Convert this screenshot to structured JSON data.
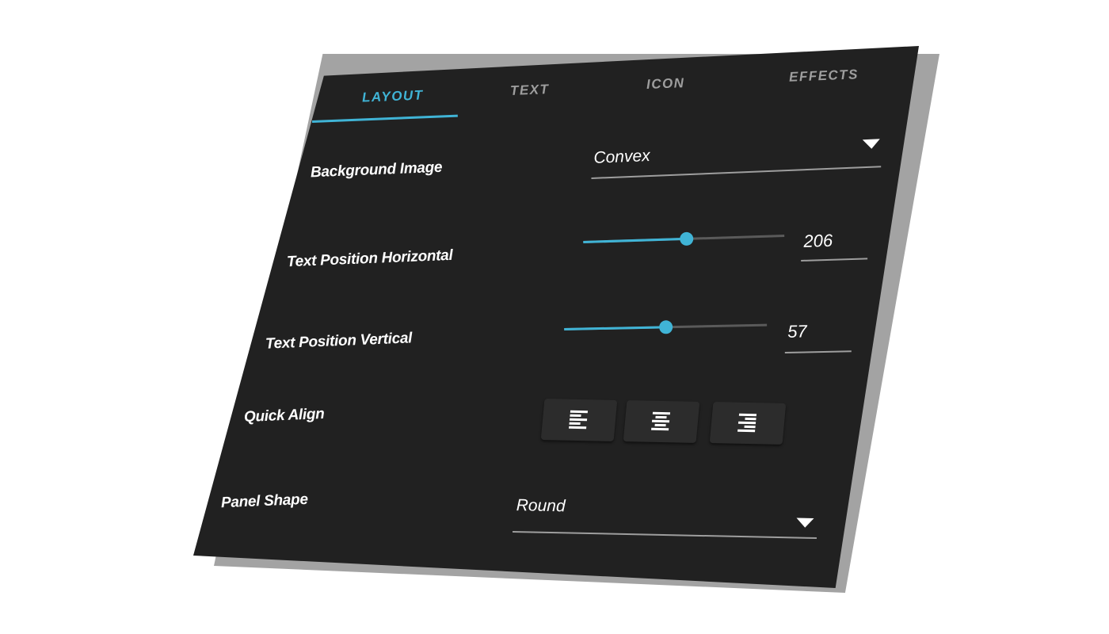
{
  "tabs": [
    {
      "label": "LAYOUT",
      "active": true
    },
    {
      "label": "TEXT",
      "active": false
    },
    {
      "label": "ICON",
      "active": false
    },
    {
      "label": "EFFECTS",
      "active": false
    }
  ],
  "rows": {
    "background_image": {
      "label": "Background Image",
      "value": "Convex",
      "icon": "chevron-down-icon"
    },
    "text_pos_h": {
      "label": "Text Position Horizontal",
      "value": "206",
      "slider_fraction": 0.51
    },
    "text_pos_v": {
      "label": "Text Position Vertical",
      "value": "57",
      "slider_fraction": 0.5
    },
    "quick_align": {
      "label": "Quick Align",
      "buttons": [
        {
          "name": "align-left",
          "icon": "align-left-icon"
        },
        {
          "name": "align-center",
          "icon": "align-center-icon"
        },
        {
          "name": "align-right",
          "icon": "align-right-icon"
        }
      ]
    },
    "panel_shape": {
      "label": "Panel Shape",
      "value": "Round",
      "icon": "chevron-down-icon"
    }
  },
  "colors": {
    "accent": "#40b4d6",
    "panel_bg": "#212121",
    "inactive_tab": "#9e9e9e",
    "text": "#ffffff"
  }
}
